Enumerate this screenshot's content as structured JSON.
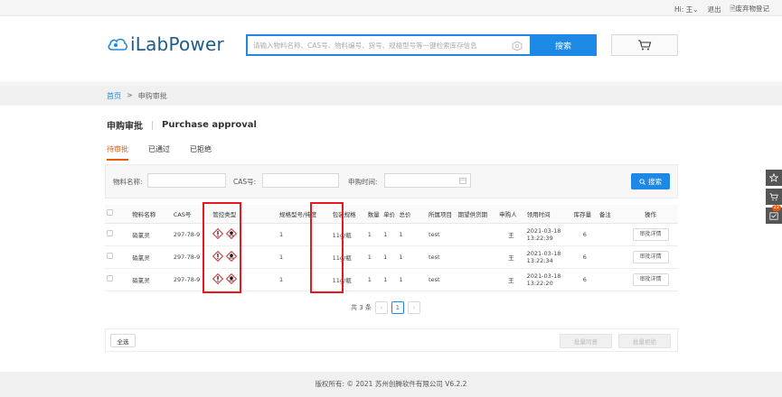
{
  "topbar": {
    "greeting": "Hi:",
    "user": "王",
    "logout": "退出",
    "waste_register": "废弃物登记"
  },
  "brand": {
    "name": "iLabPower"
  },
  "search": {
    "placeholder": "请输入物料名称、CAS号、物料编号、货号、规格型号等一键检索库存信息",
    "button": "搜索"
  },
  "breadcrumb": {
    "home": "首页",
    "separator": ">",
    "current": "申购审批"
  },
  "page": {
    "title_cn": "申购审批",
    "title_en": "Purchase approval"
  },
  "tabs": [
    {
      "label": "待审批",
      "active": true
    },
    {
      "label": "已通过",
      "active": false
    },
    {
      "label": "已拒绝",
      "active": false
    }
  ],
  "filters": {
    "material_name_label": "物料名称:",
    "cas_label": "CAS号:",
    "time_label": "申购时间:",
    "search_button": "搜索"
  },
  "table": {
    "headers": [
      "物料名称",
      "CAS号",
      "管控类型",
      "规格型号/纯度",
      "包装规格",
      "数量",
      "单价",
      "总价",
      "所属项目",
      "期望供货期",
      "申购人",
      "领用时间",
      "库存量",
      "备注",
      "操作"
    ],
    "rows": [
      {
        "name": "硝氯灵",
        "cas": "297-78-9",
        "spec": "1",
        "pack": "11g/瓶",
        "qty": "1",
        "price": "1",
        "total": "1",
        "project": "test",
        "expected": "",
        "applicant": "王",
        "time_date": "2021-03-18",
        "time_clock": "13:22:39",
        "stock": "6",
        "remark": "",
        "action": "审批详情"
      },
      {
        "name": "硝氯灵",
        "cas": "297-78-9",
        "spec": "1",
        "pack": "11g/瓶",
        "qty": "1",
        "price": "1",
        "total": "1",
        "project": "test",
        "expected": "",
        "applicant": "王",
        "time_date": "2021-03-18",
        "time_clock": "13:22:34",
        "stock": "6",
        "remark": "",
        "action": "审批详情"
      },
      {
        "name": "硝氯灵",
        "cas": "297-78-9",
        "spec": "1",
        "pack": "11g/瓶",
        "qty": "1",
        "price": "1",
        "total": "1",
        "project": "test",
        "expected": "",
        "applicant": "王",
        "time_date": "2021-03-18",
        "time_clock": "13:22:20",
        "stock": "6",
        "remark": "",
        "action": "审批详情"
      }
    ]
  },
  "pagination": {
    "total_text": "共 3 条",
    "current_page": "1"
  },
  "bottom": {
    "select_all": "全选",
    "batch_approve": "批量同意",
    "batch_reject": "批量拒绝"
  },
  "footer": {
    "copyright": "版权所有: © 2021 苏州创腾软件有限公司 V6.2.2"
  },
  "side_toolbar": {
    "message_badge": "22"
  },
  "colors": {
    "accent": "#1e88e5",
    "tab_active": "#e8590c",
    "highlight": "#e8191e"
  }
}
